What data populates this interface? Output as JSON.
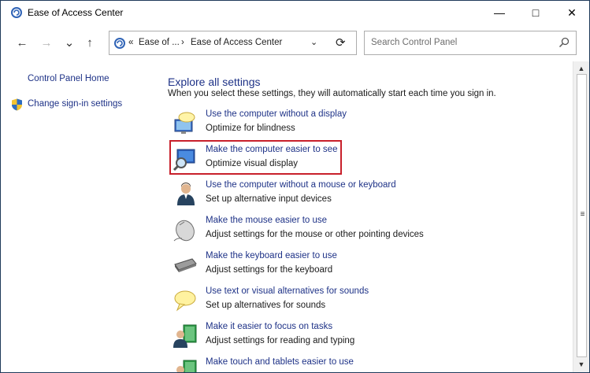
{
  "window": {
    "title": "Ease of Access Center",
    "minimize_glyph": "—",
    "maximize_glyph": "□",
    "close_glyph": "✕"
  },
  "nav": {
    "back_glyph": "←",
    "forward_glyph": "→",
    "recent_glyph": "⌄",
    "up_glyph": "↑",
    "breadcrumb": [
      {
        "label": "«"
      },
      {
        "label": "Ease of ..."
      },
      {
        "label": "›"
      },
      {
        "label": "Ease of Access Center"
      }
    ],
    "dropdown_glyph": "⌄",
    "refresh_glyph": "⟳",
    "search_placeholder": "Search Control Panel"
  },
  "sidebar": {
    "items": [
      {
        "label": "Control Panel Home"
      },
      {
        "label": "Change sign-in settings"
      }
    ]
  },
  "main": {
    "heading": "Explore all settings",
    "description": "When you select these settings, they will automatically start each time you sign in.",
    "items": [
      {
        "link": "Use the computer without a display",
        "sub": "Optimize for blindness",
        "icon": "display-speech-icon"
      },
      {
        "link": "Make the computer easier to see",
        "sub": "Optimize visual display",
        "icon": "magnifier-monitor-icon"
      },
      {
        "link": "Use the computer without a mouse or keyboard",
        "sub": "Set up alternative input devices",
        "icon": "user-icon"
      },
      {
        "link": "Make the mouse easier to use",
        "sub": "Adjust settings for the mouse or other pointing devices",
        "icon": "mouse-icon"
      },
      {
        "link": "Make the keyboard easier to use",
        "sub": "Adjust settings for the keyboard",
        "icon": "keyboard-icon"
      },
      {
        "link": "Use text or visual alternatives for sounds",
        "sub": "Set up alternatives for sounds",
        "icon": "speech-bubble-icon"
      },
      {
        "link": "Make it easier to focus on tasks",
        "sub": "Adjust settings for reading and typing",
        "icon": "focus-user-icon"
      },
      {
        "link": "Make touch and tablets easier to use",
        "sub": "",
        "icon": "tablet-user-icon"
      }
    ]
  },
  "scrollbar": {
    "up_glyph": "▲",
    "down_glyph": "▼",
    "grip_glyph": "≡"
  },
  "colors": {
    "link": "#1e3287",
    "highlight": "#c8202b"
  }
}
